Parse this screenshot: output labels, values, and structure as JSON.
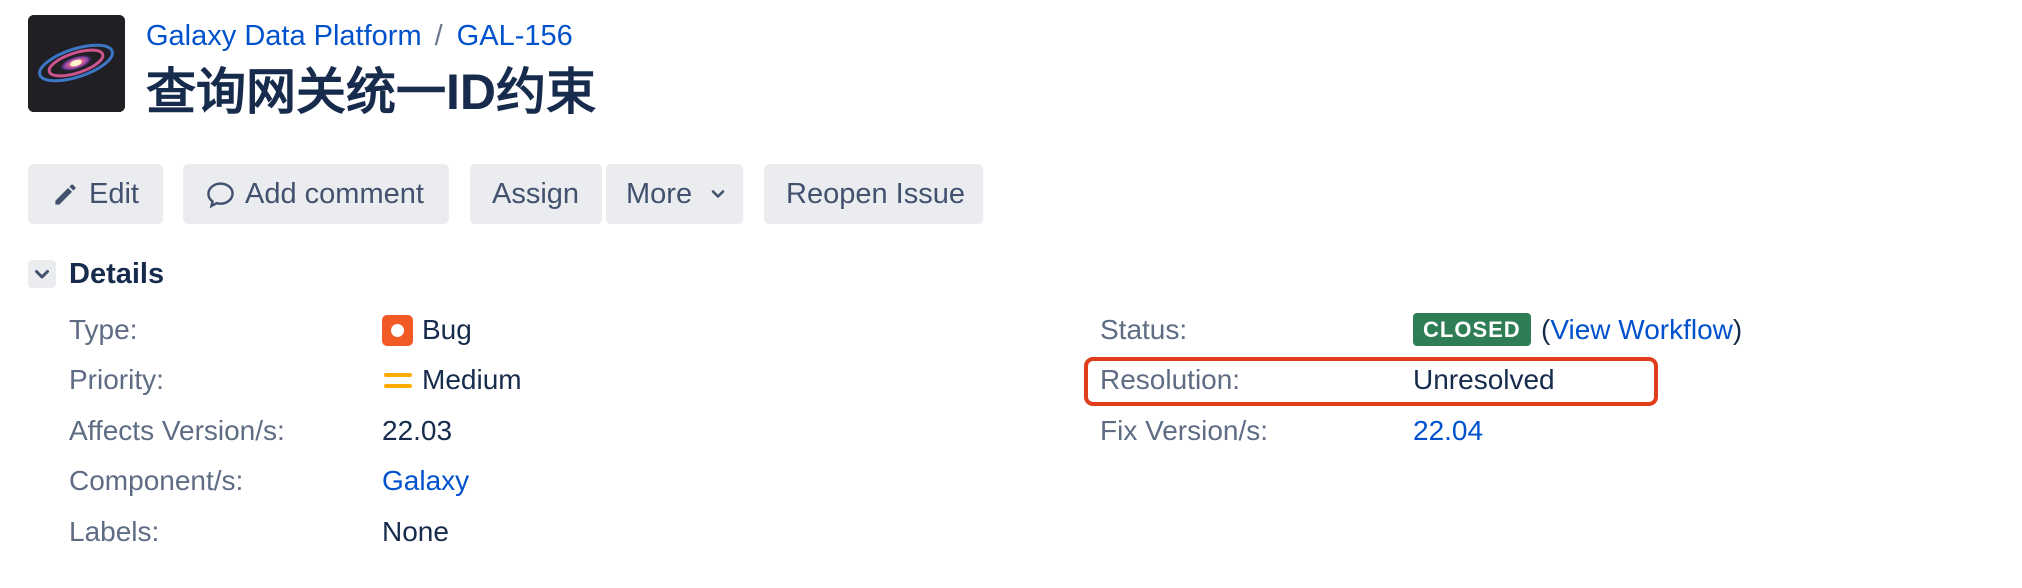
{
  "header": {
    "project_name": "Galaxy Data Platform",
    "separator": "/",
    "issue_key": "GAL-156",
    "title": "查询网关统一ID约束"
  },
  "toolbar": {
    "edit_label": "Edit",
    "comment_label": "Add comment",
    "assign_label": "Assign",
    "more_label": "More",
    "reopen_label": "Reopen Issue"
  },
  "details": {
    "heading": "Details",
    "left": {
      "type_label": "Type:",
      "type_value": "Bug",
      "priority_label": "Priority:",
      "priority_value": "Medium",
      "affects_label": "Affects Version/s:",
      "affects_value": "22.03",
      "component_label": "Component/s:",
      "component_value": "Galaxy",
      "labels_label": "Labels:",
      "labels_value": "None"
    },
    "right": {
      "status_label": "Status:",
      "status_value": "CLOSED",
      "paren_open": "(",
      "workflow_link": "View Workflow",
      "paren_close": ")",
      "resolution_label": "Resolution:",
      "resolution_value": "Unresolved",
      "fix_label": "Fix Version/s:",
      "fix_value": "22.04"
    }
  },
  "colors": {
    "link": "#0052cc",
    "status_closed": "#2e7d55",
    "highlight": "#e03e1a",
    "bug": "#f15a24",
    "priority_medium": "#ffab00"
  },
  "icons": [
    "galaxy-avatar-icon",
    "pencil-icon",
    "comment-bubble-icon",
    "chevron-down-icon",
    "bug-icon",
    "priority-medium-icon"
  ]
}
